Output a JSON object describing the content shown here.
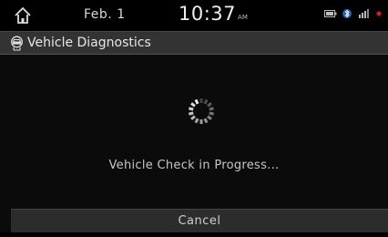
{
  "status_bar": {
    "date": "Feb.  1",
    "time": "10:37",
    "ampm": "AM",
    "icons": [
      "home-icon",
      "battery-icon",
      "bluetooth-icon",
      "signal-icon",
      "dot-icon"
    ]
  },
  "title_bar": {
    "icon": "car-diagnostics-icon",
    "title": "Vehicle Diagnostics"
  },
  "main": {
    "spinner_icon": "loading-spinner-icon",
    "message": "Vehicle Check in Progress..."
  },
  "footer": {
    "cancel_label": "Cancel"
  },
  "colors": {
    "background": "#0b0b0b",
    "title_bar": "#333333",
    "button_bar": "#2c2c2c",
    "status_accent_red": "#d02020"
  }
}
